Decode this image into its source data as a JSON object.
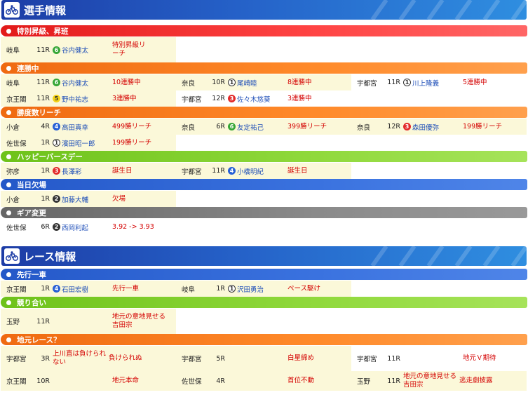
{
  "players_title": "選手情報",
  "race_title": "レース情報",
  "sections": {
    "s1": "特別昇級、昇班",
    "s2": "連勝中",
    "s3": "勝度数リーチ",
    "s4": "ハッピーバースデー",
    "s5": "当日欠場",
    "s6": "ギア変更",
    "s7": "先行一車",
    "s8": "競り合い",
    "s9": "地元レース？"
  },
  "rows": {
    "r1": [
      {
        "venue": "岐阜",
        "race": "11R",
        "num": "6",
        "player": "谷内健太",
        "note": "特別昇級リーチ"
      }
    ],
    "r2": [
      {
        "venue": "岐阜",
        "race": "11R",
        "num": "6",
        "player": "谷内健太",
        "note": "10連勝中"
      },
      {
        "venue": "奈良",
        "race": "10R",
        "num": "1",
        "player": "尾崎睦",
        "note": "8連勝中"
      },
      {
        "venue": "宇都宮",
        "race": "11R",
        "num": "1",
        "player": "川上隆義",
        "note": "5連勝中"
      }
    ],
    "r3": [
      {
        "venue": "京王閣",
        "race": "11R",
        "num": "5",
        "player": "野中祐志",
        "note": "3連勝中"
      },
      {
        "venue": "宇都宮",
        "race": "12R",
        "num": "3",
        "player": "佐々木悠葵",
        "note": "3連勝中"
      }
    ],
    "r4": [
      {
        "venue": "小倉",
        "race": "4R",
        "num": "4",
        "player": "高田真幸",
        "note": "499勝リーチ"
      },
      {
        "venue": "奈良",
        "race": "6R",
        "num": "6",
        "player": "友定祐己",
        "note": "399勝リーチ"
      },
      {
        "venue": "奈良",
        "race": "12R",
        "num": "3",
        "player": "森田優弥",
        "note": "199勝リーチ"
      }
    ],
    "r5": [
      {
        "venue": "佐世保",
        "race": "1R",
        "num": "1",
        "player": "濱田昭一郎",
        "note": "199勝リーチ"
      }
    ],
    "r6": [
      {
        "venue": "弥彦",
        "race": "1R",
        "num": "3",
        "player": "長澤彩",
        "note": "誕生日"
      },
      {
        "venue": "宇都宮",
        "race": "11R",
        "num": "4",
        "player": "小橋明紀",
        "note": "誕生日"
      }
    ],
    "r7": [
      {
        "venue": "小倉",
        "race": "1R",
        "num": "2",
        "player": "加藤大輔",
        "note": "欠場"
      }
    ],
    "r8": [
      {
        "venue": "佐世保",
        "race": "6R",
        "num": "2",
        "player": "西岡利起",
        "note": "3.92 -> 3.93"
      }
    ],
    "r9": [
      {
        "venue": "京王閣",
        "race": "1R",
        "num": "4",
        "player": "石田宏樹",
        "note": "先行一車"
      },
      {
        "venue": "岐阜",
        "race": "1R",
        "num": "1",
        "player": "沢田勇治",
        "note": "ペース駆け"
      }
    ],
    "r10": [
      {
        "venue": "玉野",
        "race": "11R",
        "player": "",
        "note": "地元の意地見せる吉田宗"
      }
    ],
    "r11": [
      {
        "venue": "宇都宮",
        "race": "3R",
        "player": "上川直は負けられない",
        "note": "負けられぬ"
      },
      {
        "venue": "宇都宮",
        "race": "5R",
        "player": "",
        "note": "白星締め"
      },
      {
        "venue": "宇都宮",
        "race": "11R",
        "player": "",
        "note": "地元Ｖ期待"
      }
    ],
    "r12": [
      {
        "venue": "京王閣",
        "race": "10R",
        "player": "",
        "note": "地元本命"
      },
      {
        "venue": "佐世保",
        "race": "4R",
        "player": "",
        "note": "首位不動"
      },
      {
        "venue": "玉野",
        "race": "11R",
        "player": "地元の意地見せる吉田宗",
        "note": "逃走劇披露"
      }
    ]
  }
}
